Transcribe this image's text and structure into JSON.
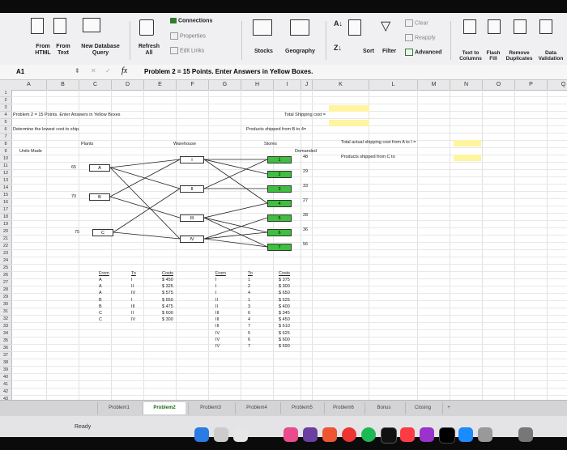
{
  "ribbon": {
    "from_html": "From\nHTML",
    "from_text": "From\nText",
    "new_db_query": "New Database\nQuery",
    "refresh_all": "Refresh\nAll",
    "connections": "Connections",
    "properties": "Properties",
    "edit_links": "Edit Links",
    "stocks": "Stocks",
    "geography": "Geography",
    "sort": "Sort",
    "filter": "Filter",
    "clear": "Clear",
    "reapply": "Reapply",
    "advanced": "Advanced",
    "text_to_columns": "Text to\nColumns",
    "flash_fill": "Flash\nFill",
    "remove_duplicates": "Remove\nDuplicates",
    "data_validation": "Data\nValidation"
  },
  "formula_bar": {
    "cell_ref": "A1",
    "fx": "fx",
    "formula": "Problem 2 = 15 Points. Enter Answers in Yellow Boxes."
  },
  "columns": [
    "A",
    "B",
    "C",
    "D",
    "E",
    "F",
    "G",
    "H",
    "I",
    "J",
    "K",
    "L",
    "M",
    "N",
    "O",
    "P",
    "Q"
  ],
  "rows": [
    "1",
    "2",
    "3",
    "4",
    "5",
    "6",
    "7",
    "8",
    "9",
    "10",
    "11",
    "12",
    "13",
    "14",
    "15",
    "16",
    "17",
    "18",
    "19",
    "20",
    "21",
    "22",
    "23",
    "24",
    "25",
    "26",
    "27",
    "28",
    "29",
    "30",
    "31",
    "32",
    "33",
    "34",
    "35",
    "36",
    "37",
    "38",
    "39",
    "40",
    "41",
    "42",
    "43",
    "44"
  ],
  "sheet": {
    "title": "Problem 2 = 15 Points. Enter Answers in Yellow Boxes",
    "instruction": "Determine the lowest cost to ship.",
    "total_shipping": "Total Shipping cost =",
    "products_b_to_4": "Products shipped from B to 4=",
    "total_actual": "Total actual shipping cost from A to I =",
    "products_c_to": "Products shipped from C to",
    "plants": "Plants",
    "warehouse": "Warehouse",
    "stores": "Stores",
    "demanded": "Demanded",
    "units_made": "Units Made"
  },
  "plants": [
    {
      "units": "65",
      "label": "A"
    },
    {
      "units": "70",
      "label": "B"
    },
    {
      "units": "75",
      "label": "C"
    }
  ],
  "warehouses": [
    "I",
    "II",
    "III",
    "IV"
  ],
  "stores": [
    {
      "label": "1",
      "demand": "48"
    },
    {
      "label": "2",
      "demand": "29"
    },
    {
      "label": "3",
      "demand": "33"
    },
    {
      "label": "4",
      "demand": "27"
    },
    {
      "label": "5",
      "demand": "28"
    },
    {
      "label": "6",
      "demand": "36"
    },
    {
      "label": "7",
      "demand": "56"
    }
  ],
  "table1": {
    "headers": [
      "From",
      "To",
      "Costs"
    ],
    "rows": [
      [
        "A",
        "I",
        "$ 450"
      ],
      [
        "A",
        "II",
        "$ 325"
      ],
      [
        "A",
        "IV",
        "$ 575"
      ],
      [
        "B",
        "I",
        "$ 650"
      ],
      [
        "B",
        "III",
        "$ 475"
      ],
      [
        "C",
        "II",
        "$ 600"
      ],
      [
        "C",
        "IV",
        "$ 300"
      ]
    ]
  },
  "table2": {
    "headers": [
      "From",
      "To",
      "Costs"
    ],
    "rows": [
      [
        "I",
        "1",
        "$ 375"
      ],
      [
        "I",
        "2",
        "$ 300"
      ],
      [
        "I",
        "4",
        "$ 650"
      ],
      [
        "II",
        "1",
        "$ 525"
      ],
      [
        "II",
        "3",
        "$ 400"
      ],
      [
        "III",
        "6",
        "$ 345"
      ],
      [
        "III",
        "4",
        "$ 450"
      ],
      [
        "III",
        "7",
        "$ 610"
      ],
      [
        "IV",
        "5",
        "$ 625"
      ],
      [
        "IV",
        "6",
        "$ 600"
      ],
      [
        "IV",
        "7",
        "$ 690"
      ]
    ]
  },
  "tabs": [
    "Problem1",
    "Problem2",
    "Problem3",
    "Problem4",
    "Problem5",
    "Problem6",
    "Bonus",
    "Closing",
    "+"
  ],
  "status": "Ready",
  "colors": {
    "accent_green": "#1a6b1a",
    "yellow_cell": "#fff4a0",
    "green_cell": "#3fbf3f"
  }
}
